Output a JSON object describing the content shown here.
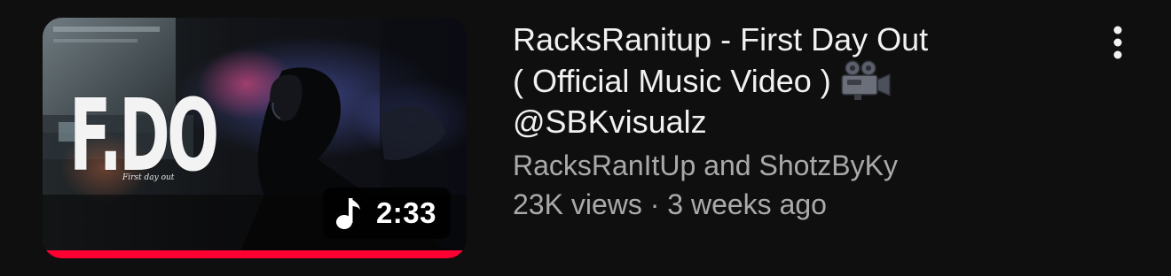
{
  "video": {
    "title_line_1": "RacksRanitup - First Day Out",
    "title_line_2": "( Official Music Video )",
    "title_line_3": "@SBKvisualz",
    "title_emoji_icon": "movie-camera-icon",
    "channel": "RacksRanItUp and ShotzByKy",
    "views": "23K views",
    "separator": "·",
    "age": "3 weeks ago",
    "duration": "2:33",
    "watch_progress_percent": 100
  },
  "thumbnail": {
    "logo_text": "F.DO",
    "logo_subtitle": "First day out"
  },
  "icons": {
    "duration_icon": "music-note-icon",
    "menu_icon": "more-vertical-icon"
  },
  "colors": {
    "background": "#0f0f0f",
    "title": "#f1f1f1",
    "secondary_text": "#aaaaaa",
    "progress": "#ff0033",
    "badge_background": "#000000"
  }
}
